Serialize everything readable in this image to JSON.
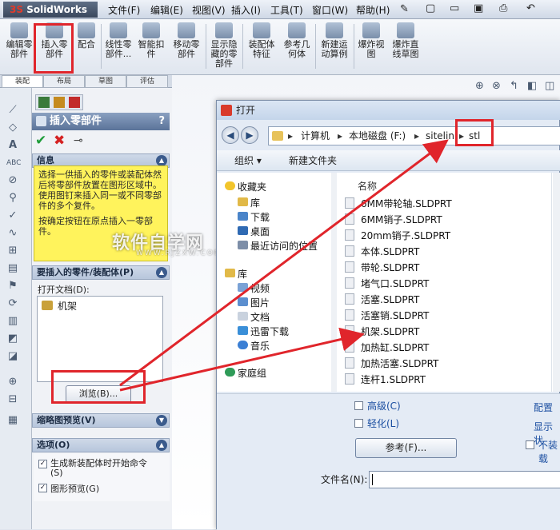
{
  "app": {
    "logo": "SolidWorks",
    "accent": "#e0252b"
  },
  "menu": [
    "文件(F)",
    "编辑(E)",
    "视图(V)",
    "插入(I)",
    "工具(T)",
    "窗口(W)",
    "帮助(H)"
  ],
  "ribbon": [
    {
      "label1": "编辑零",
      "label2": "部件"
    },
    {
      "label1": "插入零",
      "label2": "部件"
    },
    {
      "label1": "配合",
      "label2": ""
    },
    {
      "label1": "线性零",
      "label2": "部件..."
    },
    {
      "label1": "智能扣",
      "label2": "件"
    },
    {
      "label1": "移动零",
      "label2": "部件"
    },
    {
      "label1": "显示隐",
      "label2": "藏的零",
      "label3": "部件"
    },
    {
      "label1": "装配体",
      "label2": "特征"
    },
    {
      "label1": "参考几",
      "label2": "何体"
    },
    {
      "label1": "新建运",
      "label2": "动算例"
    },
    {
      "label1": "爆炸视",
      "label2": "图"
    },
    {
      "label1": "爆炸直",
      "label2": "线草图"
    }
  ],
  "tabs": [
    "装配",
    "布局",
    "草图",
    "评估"
  ],
  "panel": {
    "title": "插入零部件",
    "help": "?",
    "info_header": "信息",
    "info_text1": "选择一供插入的零件或装配体然后将零部件放置在图形区域中。使用图钉来插入同一或不同零部件的多个复件。",
    "info_text2": "按确定按钮在原点插入一零部件。",
    "parts_header": "要插入的零件/装配体(P)",
    "open_docs_label": "打开文档(D):",
    "open_doc_item": "机架",
    "browse_button": "浏览(B)...",
    "thumb_header": "缩略图预览(V)",
    "options_header": "选项(O)",
    "opt1": "生成新装配体时开始命令",
    "opt1b": "(S)",
    "opt2": "图形预览(G)"
  },
  "watermark": {
    "text": "软件自学网",
    "sub": "WWW.RJZXW.COM"
  },
  "dialog": {
    "title": "打开",
    "path": [
      "计算机",
      "本地磁盘 (F:)",
      "sitelin",
      "stl"
    ],
    "organize": "组织 ▾",
    "new_folder": "新建文件夹",
    "nav": {
      "favorites": "收藏夹",
      "fav_items": [
        "库",
        "下载",
        "桌面",
        "最近访问的位置"
      ],
      "libraries": "库",
      "lib_items": [
        "视频",
        "图片",
        "文档",
        "迅雷下载",
        "音乐"
      ],
      "homegroup": "家庭组"
    },
    "col_name": "名称",
    "col_date": "修",
    "files": [
      "6MM带轮轴.SLDPRT",
      "6MM销子.SLDPRT",
      "20mm销子.SLDPRT",
      "本体.SLDPRT",
      "带轮.SLDPRT",
      "堵气口.SLDPRT",
      "活塞.SLDPRT",
      "活塞销.SLDPRT",
      "机架.SLDPRT",
      "加热缸.SLDPRT",
      "加热活塞.SLDPRT",
      "连杆1.SLDPRT"
    ],
    "file_dates": [
      "2",
      "2",
      "2",
      "2",
      "2",
      "2",
      "2",
      "2",
      "2",
      "2",
      "2",
      "2"
    ],
    "advanced": "高级(C)",
    "lightweight": "轻化(L)",
    "config": "配置",
    "show_states": "显示状",
    "no_load": "不装载",
    "ref_button": "参考(F)...",
    "filename_label": "文件名(N):"
  }
}
